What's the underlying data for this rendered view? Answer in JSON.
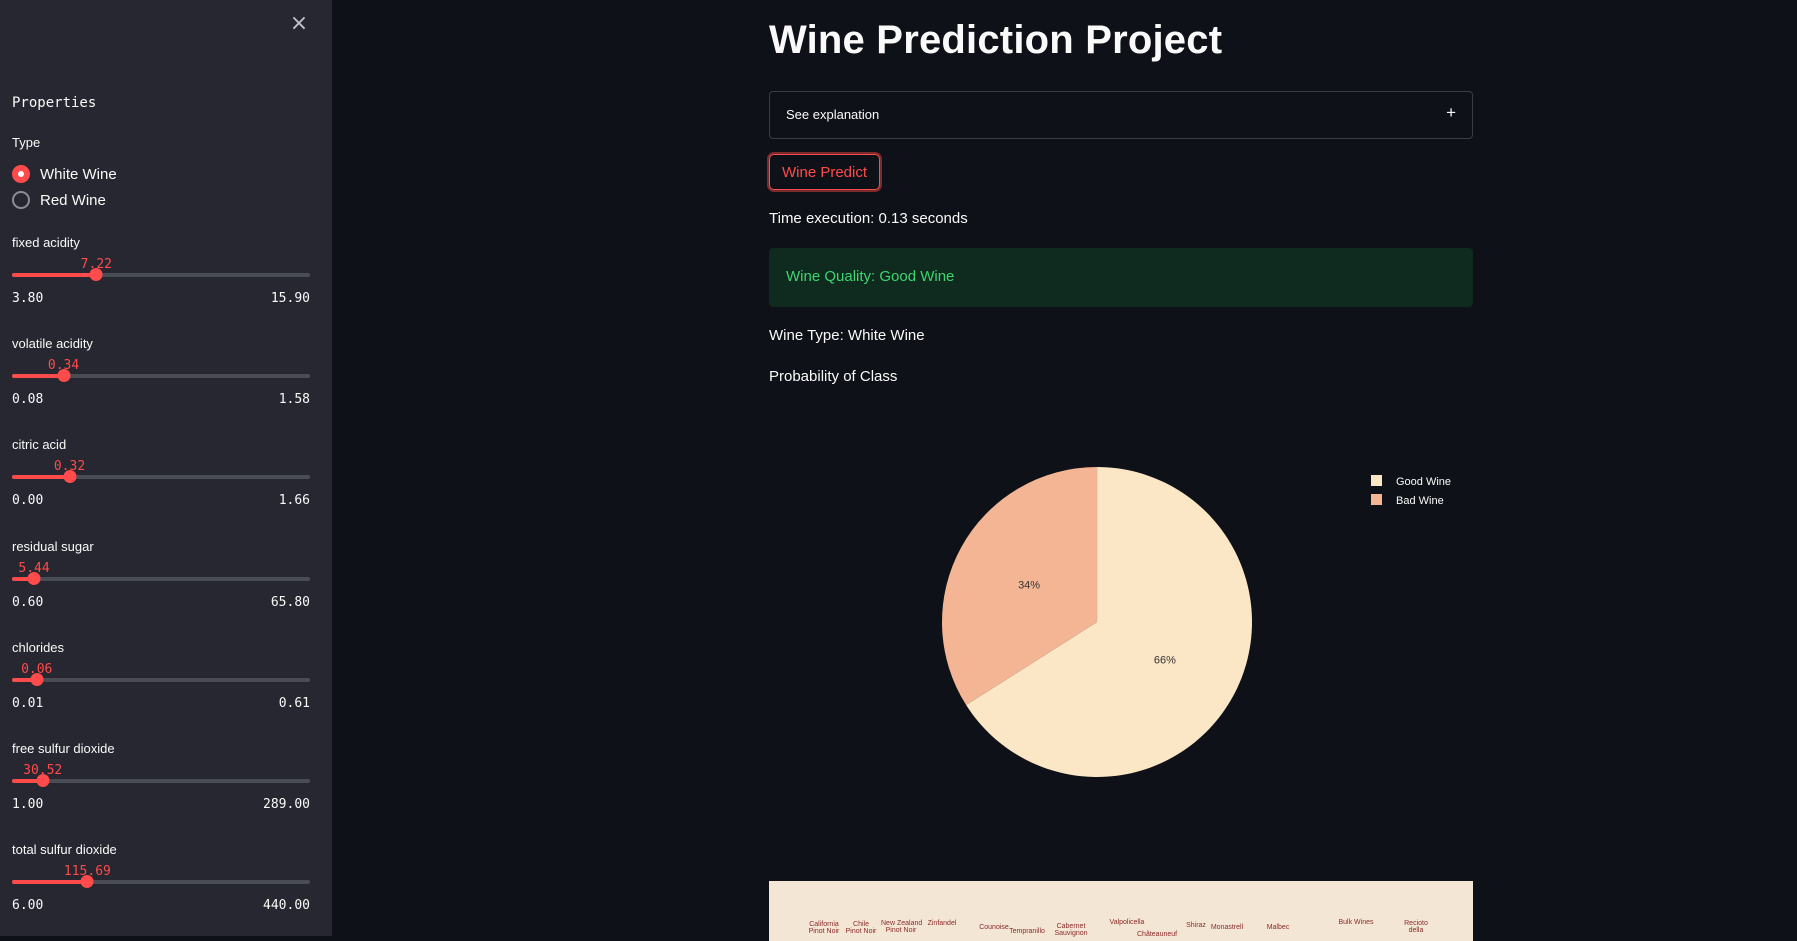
{
  "sidebar": {
    "close_icon": "×",
    "heading": "Properties",
    "type_label": "Type",
    "type_options": [
      {
        "label": "White Wine",
        "selected": true
      },
      {
        "label": "Red Wine",
        "selected": false
      }
    ],
    "sliders": [
      {
        "label": "fixed acidity",
        "value": "7.22",
        "min": "3.80",
        "max": "15.90",
        "fraction": 0.283
      },
      {
        "label": "volatile acidity",
        "value": "0.34",
        "min": "0.08",
        "max": "1.58",
        "fraction": 0.173
      },
      {
        "label": "citric acid",
        "value": "0.32",
        "min": "0.00",
        "max": "1.66",
        "fraction": 0.193
      },
      {
        "label": "residual sugar",
        "value": "5.44",
        "min": "0.60",
        "max": "65.80",
        "fraction": 0.074
      },
      {
        "label": "chlorides",
        "value": "0.06",
        "min": "0.01",
        "max": "0.61",
        "fraction": 0.083
      },
      {
        "label": "free sulfur dioxide",
        "value": "30.52",
        "min": "1.00",
        "max": "289.00",
        "fraction": 0.103
      },
      {
        "label": "total sulfur dioxide",
        "value": "115.69",
        "min": "6.00",
        "max": "440.00",
        "fraction": 0.253
      }
    ]
  },
  "main": {
    "title": "Wine Prediction Project",
    "expander_label": "See explanation",
    "expander_icon": "+",
    "predict_button": "Wine Predict",
    "time_text": "Time execution: 0.13 seconds",
    "result_text": "Wine Quality: Good Wine",
    "type_text": "Wine Type: White Wine",
    "probability_heading": "Probability of Class",
    "image_labels": [
      "California\nPinot Noir",
      "Chile\nPinot Noir",
      "New Zealand\nPinot Noir",
      "Zinfandel",
      "Counoise",
      "Tempranillo",
      "Cabernet\nSauvignon",
      "Valpolicella",
      "Châteauneuf",
      "Shiraz",
      "Monastrell",
      "Malbec",
      "Bulk Wines",
      "Recioto\ndella"
    ]
  },
  "colors": {
    "accent": "#ff4b4b",
    "success": "#3dd56d",
    "good_wine": "#fbe6c6",
    "bad_wine": "#f3b593"
  },
  "chart_data": {
    "type": "pie",
    "series": [
      {
        "name": "Good Wine",
        "value": 66,
        "label": "66%"
      },
      {
        "name": "Bad Wine",
        "value": 34,
        "label": "34%"
      }
    ],
    "legend": [
      "Good Wine",
      "Bad Wine"
    ],
    "legend_position": "top-right"
  }
}
